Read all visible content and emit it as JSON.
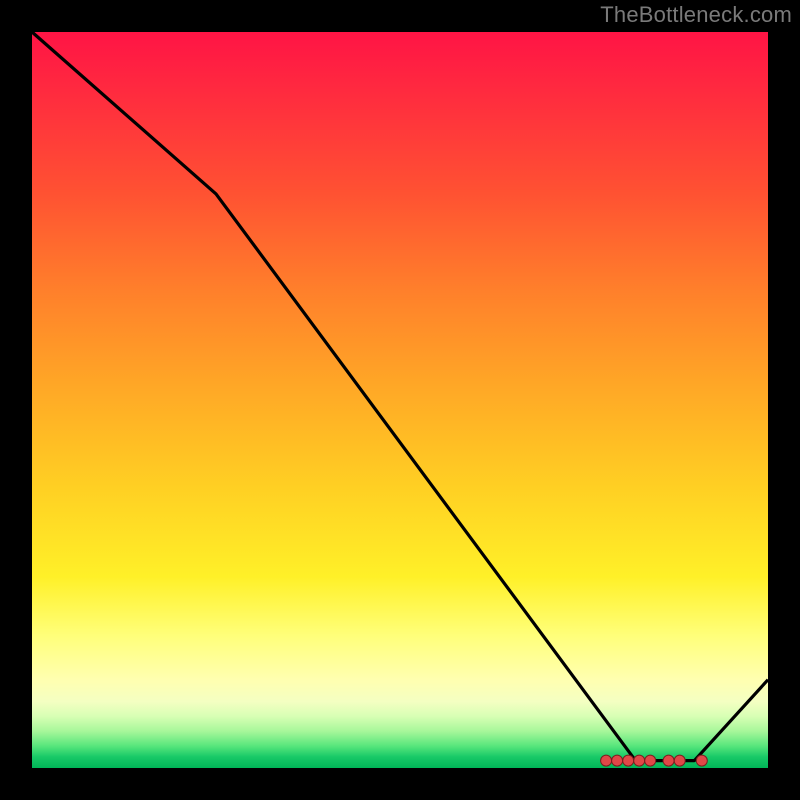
{
  "attribution": "TheBottleneck.com",
  "chart_data": {
    "type": "line",
    "title": "",
    "xlabel": "",
    "ylabel": "",
    "ylim": [
      0,
      100
    ],
    "xlim": [
      0,
      100
    ],
    "series": [
      {
        "name": "curve",
        "x": [
          0,
          25,
          82,
          90,
          100
        ],
        "y": [
          100,
          78,
          1,
          1,
          12
        ]
      }
    ],
    "markers": {
      "name": "bottom-cluster",
      "points": [
        {
          "x": 78.0,
          "y": 1.0
        },
        {
          "x": 79.5,
          "y": 1.0
        },
        {
          "x": 81.0,
          "y": 1.0
        },
        {
          "x": 82.5,
          "y": 1.0
        },
        {
          "x": 84.0,
          "y": 1.0
        },
        {
          "x": 86.5,
          "y": 1.0
        },
        {
          "x": 88.0,
          "y": 1.0
        },
        {
          "x": 91.0,
          "y": 1.0
        }
      ]
    },
    "colors": {
      "line": "#000000",
      "marker_fill": "#e04848",
      "marker_stroke": "#7a1f1f"
    }
  }
}
